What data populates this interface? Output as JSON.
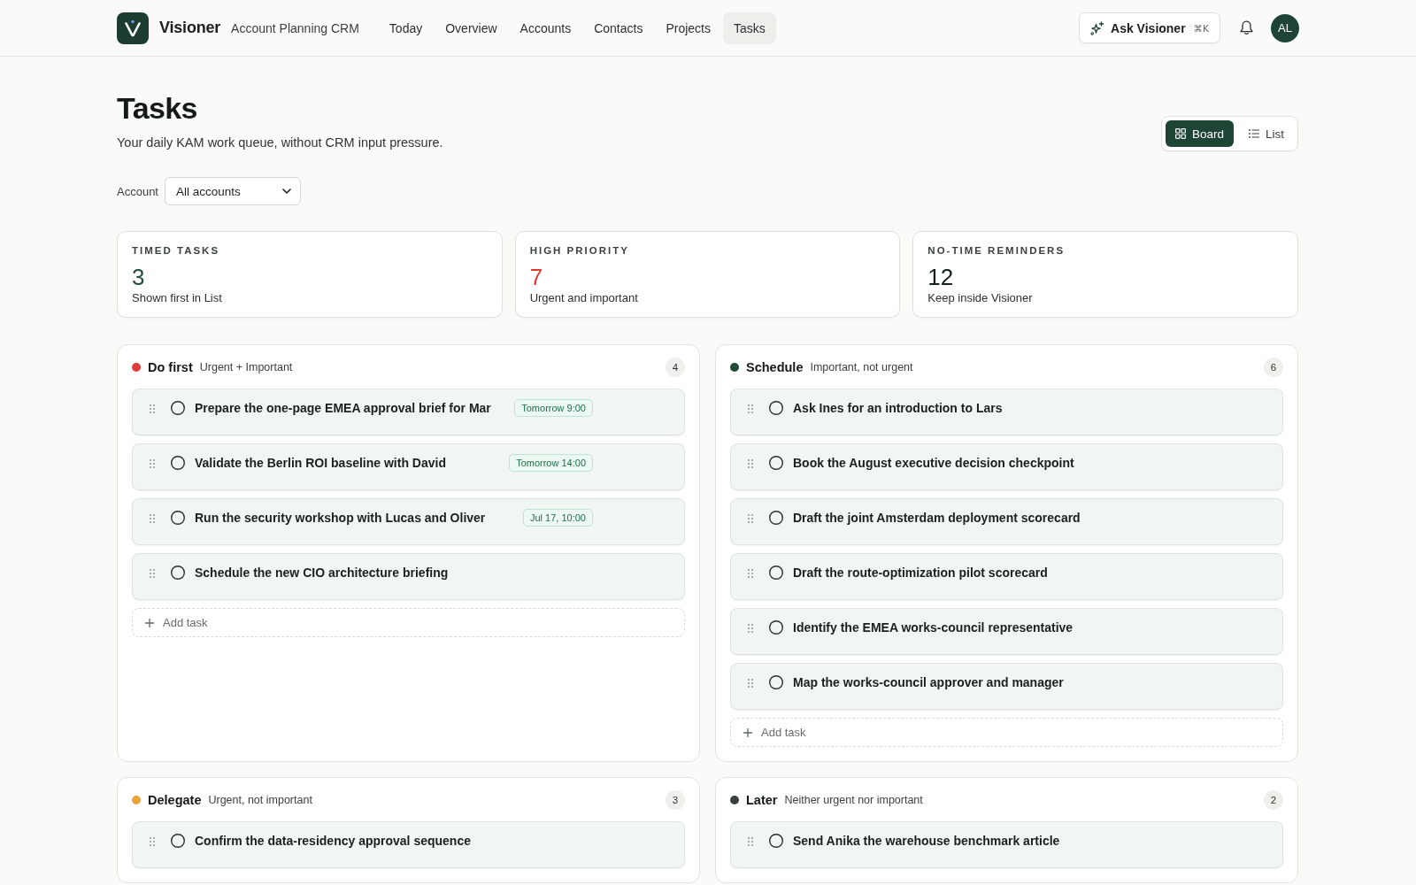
{
  "header": {
    "brand": "Visioner",
    "product": "Account Planning CRM",
    "nav": [
      {
        "label": "Today",
        "selected": false
      },
      {
        "label": "Overview",
        "selected": false
      },
      {
        "label": "Accounts",
        "selected": false
      },
      {
        "label": "Contacts",
        "selected": false
      },
      {
        "label": "Projects",
        "selected": false
      },
      {
        "label": "Tasks",
        "selected": true
      }
    ],
    "ask_button": {
      "label": "Ask Visioner",
      "shortcut": "⌘K"
    },
    "avatar": "AL"
  },
  "page": {
    "title": "Tasks",
    "subtitle": "Your daily KAM work queue, without CRM input pressure.",
    "views": [
      {
        "kind": "board",
        "label": "Board",
        "selected": true
      },
      {
        "kind": "list",
        "label": "List",
        "selected": false
      }
    ],
    "filter": {
      "label": "Account",
      "value": "All accounts"
    }
  },
  "stats": [
    {
      "label": "TIMED TASKS",
      "value": "3",
      "note": "Shown first in List",
      "color": "#244d3a"
    },
    {
      "label": "HIGH PRIORITY",
      "value": "7",
      "note": "Urgent and important",
      "color": "#dc3a32"
    },
    {
      "label": "NO-TIME REMINDERS",
      "value": "12",
      "note": "Keep inside Visioner",
      "color": "#16201b"
    }
  ],
  "quadrants": [
    {
      "title": "Do first",
      "subtitle": "Urgent + Important",
      "color": "#e03c3c",
      "count": "4",
      "tasks": [
        {
          "title": "Prepare the one-page EMEA approval brief for Mar",
          "checked": false,
          "due": "Tomorrow 9:00"
        },
        {
          "title": "Validate the Berlin ROI baseline with David",
          "checked": false,
          "due": "Tomorrow 14:00"
        },
        {
          "title": "Run the security workshop with Lucas and Oliver",
          "checked": false,
          "due": "Jul 17, 10:00"
        },
        {
          "title": "Schedule the new CIO architecture briefing",
          "checked": false
        }
      ],
      "add_label": "Add task"
    },
    {
      "title": "Schedule",
      "subtitle": "Important, not urgent",
      "color": "#1f4a36",
      "count": "6",
      "tasks": [
        {
          "title": "Ask Ines for an introduction to Lars",
          "checked": false
        },
        {
          "title": "Book the August executive decision checkpoint",
          "checked": false
        },
        {
          "title": "Draft the joint Amsterdam deployment scorecard",
          "checked": false
        },
        {
          "title": "Draft the route-optimization pilot scorecard",
          "checked": false
        },
        {
          "title": "Identify the EMEA works-council representative",
          "checked": false
        },
        {
          "title": "Map the works-council approver and manager",
          "checked": false
        }
      ],
      "add_label": "Add task"
    },
    {
      "title": "Delegate",
      "subtitle": "Urgent, not important",
      "color": "#eaa23a",
      "count": "3",
      "tasks": [
        {
          "title": "Confirm the data-residency approval sequence",
          "checked": false
        }
      ]
    },
    {
      "title": "Later",
      "subtitle": "Neither urgent nor important",
      "color": "#3b403d",
      "count": "2",
      "tasks": [
        {
          "title": "Send Anika the warehouse benchmark article",
          "checked": false
        }
      ]
    }
  ]
}
